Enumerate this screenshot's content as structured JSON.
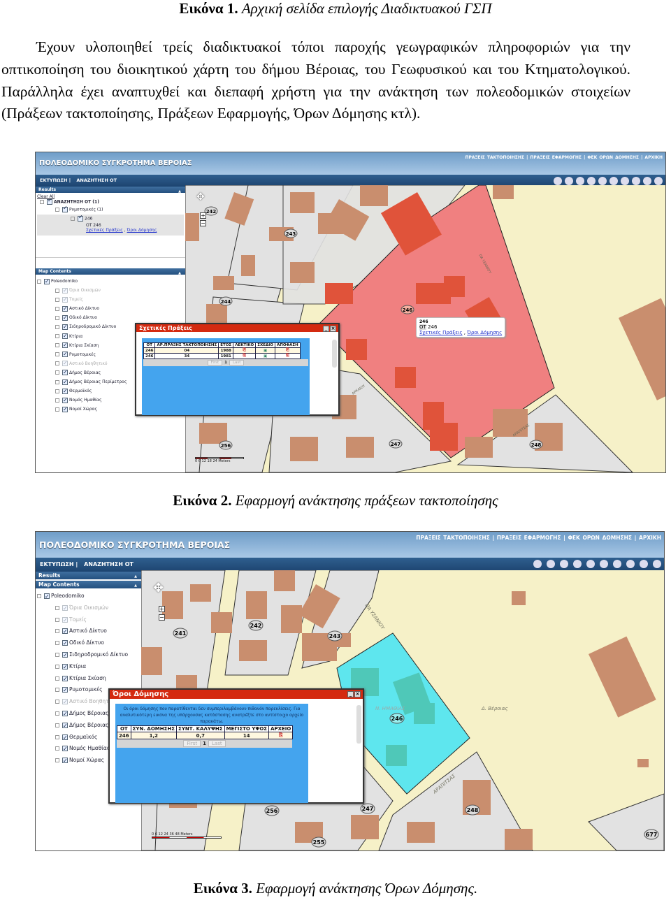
{
  "caption1": {
    "label": "Εικόνα 1.",
    "text": "Αρχική σελίδα επιλογής Διαδικτυακού ΓΣΠ"
  },
  "paragraph": "Έχουν υλοποιηθεί τρείς διαδικτυακοί τόποι παροχής γεωγραφικών πληροφοριών για την οπτικοποίηση του διοικητικού χάρτη του δήμου Βέροιας, του Γεωφυσικού και του Κτηματολογικού. Παράλληλα έχει αναπτυχθεί και διεπαφή χρήστη για την ανάκτηση των πολεοδομικών στοιχείων (Πράξεων τακτοποίησης, Πράξεων Εφαρμογής, Όρων Δόμησης κτλ).",
  "app": {
    "title": "ΠΟΛΕΟΔΟΜΙΚΟ ΣΥΓΚΡΟΤΗΜΑ ΒΕΡΟΙΑΣ",
    "top_links": [
      "ΠΡΑΞΕΙΣ ΤΑΚΤΟΠΟΙΗΣΗΣ",
      "ΠΡΑΞΕΙΣ ΕΦΑΡΜΟΓΗΣ",
      "ΦΕΚ ΟΡΩΝ ΔΟΜΗΣΗΣ",
      "ΑΡΧΙΚΗ"
    ],
    "link_sep": "|",
    "nav": [
      "ΕΚΤΥΠΩΣΗ",
      "ΑΝΑΖΗΤΗΣΗ ΟΤ"
    ],
    "tools": [
      "zoom-in-icon",
      "zoom-out-icon",
      "pan-hand-icon",
      "full-extent-globe-icon",
      "back-arrow-icon",
      "forward-arrow-icon",
      "select-icon",
      "info-icon",
      "print-icon",
      "measure-icon"
    ],
    "results_title": "Results",
    "clear_all": "Clear All",
    "results_tree": {
      "root": "ΑΝΑΖΗΤΗΣΗ ΟΤ (1)",
      "layer": "Ρυμοτομικές (1)",
      "item": "246",
      "ot": "ΟΤ 246",
      "link1": "Σχετικές Πράξεις",
      "link_sep": ",",
      "link2": "Όροι Δόμησης"
    },
    "map_contents_title": "Map Contents",
    "layers_root": "Poleodomiko",
    "layers": [
      {
        "name": "Όρια Οικισμών",
        "enabled": false
      },
      {
        "name": "Τομείς",
        "enabled": false
      },
      {
        "name": "Αστικό Δίκτυο",
        "enabled": true
      },
      {
        "name": "Οδικό Δίκτυο",
        "enabled": true
      },
      {
        "name": "Σιδηροδρομικό Δίκτυο",
        "enabled": true
      },
      {
        "name": "Κτίρια",
        "enabled": true
      },
      {
        "name": "Κτίρια Σκίαση",
        "enabled": true
      },
      {
        "name": "Ρυμοτομικές",
        "enabled": true
      },
      {
        "name": "Αστικό Βοηθητικό",
        "enabled": false
      },
      {
        "name": "Δήμος Βέροιας",
        "enabled": true
      },
      {
        "name": "Δήμος Βέροιας Περίμετρος",
        "enabled": true
      },
      {
        "name": "Θερμαϊκός",
        "enabled": true
      },
      {
        "name": "Νομός Ημαθίας",
        "enabled": true
      },
      {
        "name": "Νομοί Χώρας",
        "enabled": true
      }
    ],
    "colors": {
      "header": "#6f9dc8",
      "nav": "#24507f",
      "popup_title": "#d42a10",
      "popup_body": "#44a4ee",
      "map_bg": "#f6f1c8",
      "block": "#e2e2e2",
      "building": "#c98e6e",
      "highlight1": "#f08080",
      "highlight2": "#5ee6ee"
    },
    "pager": {
      "first": "First",
      "page": "1",
      "last": "Last"
    }
  },
  "figure1": {
    "map_labels": [
      "242",
      "243",
      "244",
      "246",
      "256",
      "247",
      "248"
    ],
    "street_labels": [
      "ΠΑ ΥΣΑΝΙΟΥ",
      "ΑΡΑΠΙΤΣΑΣ",
      "ΑΡΧΑΙΟΥ"
    ],
    "scale_labels": "0 6 12 18 24 Meters",
    "info_popup": {
      "title": "246",
      "ot_label": "ΟΤ",
      "ot_value": "246",
      "link1": "Σχετικές Πράξεις",
      "sep": ",",
      "link2": "Όροι Δόμησης"
    },
    "dialog": {
      "title": "Σχετικές Πράξεις",
      "columns": [
        "ΟΤ",
        "ΑΡ.ΠΡΑΞΗΣ ΤΑΚΤΟΠΟΙΗΣΗΣ",
        "ΕΤΟΣ",
        "ΛΕΚΤΙΚΟ",
        "ΣΧΕΔΙΟ",
        "ΑΠΟΦΑΣΗ"
      ],
      "rows": [
        {
          "ot": "246",
          "num": "04",
          "year": "1988",
          "lektiko": "pdf-icon",
          "sxedio": "image-icon",
          "apofasi": "pdf-icon"
        },
        {
          "ot": "246",
          "num": "34",
          "year": "1981",
          "lektiko": "pdf-icon",
          "sxedio": "image-icon",
          "apofasi": "pdf-icon"
        }
      ]
    }
  },
  "caption2": {
    "label": "Εικόνα 2.",
    "text": "Εφαρμογή ανάκτησης πράξεων τακτοποίησης"
  },
  "figure2": {
    "map_labels": [
      "241",
      "242",
      "243",
      "246",
      "256",
      "247",
      "248",
      "255",
      "677"
    ],
    "place_labels": [
      "Δ. Βέροιας",
      "Ν. ΗΜΑΘΙΑΣ"
    ],
    "street_labels": [
      "ΠΑ ΥΣΑΝΙΟΥ",
      "ΑΡΑΠΙΤΣΑΣ"
    ],
    "scale_labels": "0 6 12 24 36 48 Meters",
    "dialog": {
      "title": "Όροι Δόμησης",
      "note": "Οι όροι δόμησης που παρατίθενται δεν συμπεριλαμβάνουν πιθανόν παρεκλίσεις. Για αναλυτικότερη εικόνα της υπάρχουσας κατάστασης ανατρέξτε στο αντίστοιχο αρχείο παρακάτω.",
      "columns": [
        "ΟΤ",
        "ΣΥΝ. ΔΟΜΗΣΗΣ",
        "ΣΥΝΤ. ΚΑΛΥΨΗΣ",
        "ΜΕΓΙΣΤΟ ΥΨΟΣ",
        "ΑΡΧΕΙΟ"
      ],
      "rows": [
        {
          "ot": "246",
          "syn_domisis": "1,2",
          "synt_kalypsis": "0,7",
          "megisto_ypsos": "14",
          "arxeio": "pdf-icon"
        }
      ]
    }
  },
  "caption3": {
    "label": "Εικόνα 3.",
    "text": "Εφαρμογή ανάκτησης Όρων Δόμησης."
  }
}
